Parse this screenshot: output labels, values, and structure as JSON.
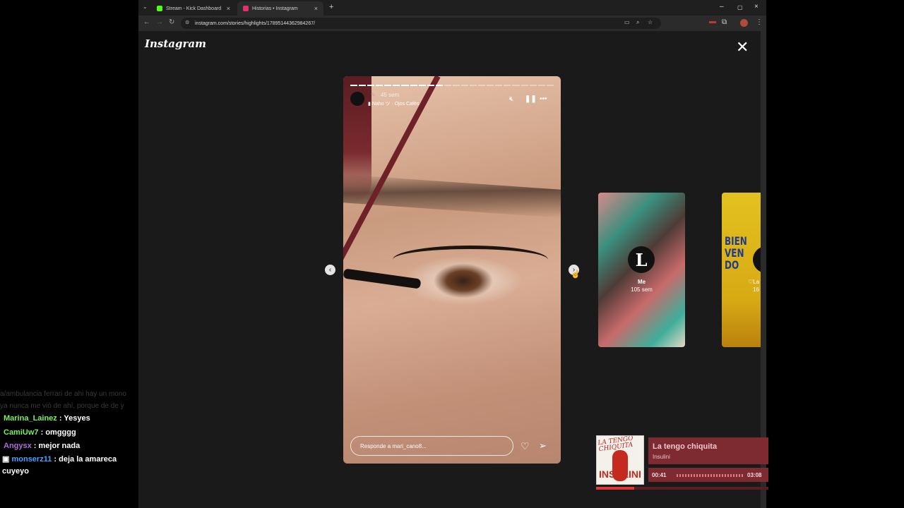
{
  "chat": {
    "faded": [
      "a/ambulancia ferrari de ahi hay un mono",
      "ya nunca me vió de ahí, porque de de y"
    ],
    "messages": [
      {
        "user": "Marina_Lainez",
        "text": "Yesyes",
        "color": "#7bf05a"
      },
      {
        "user": "CamiUw7",
        "text": "omgggg",
        "color": "#7bf05a"
      },
      {
        "user": "Angysx",
        "text": "mejor nada",
        "color": "#b06be0"
      },
      {
        "user": "monserz11",
        "text": "deja la amareca cuyeyo",
        "color": "#4da0ff"
      }
    ]
  },
  "browser": {
    "tabs": [
      {
        "title": "Stream - Kick Dashboard",
        "favicon_color": "#53fc18"
      },
      {
        "title": "Historias • Instagram",
        "favicon_color": "#e1306c"
      }
    ],
    "url": "instagram.com/stories/highlights/17895144362984267/"
  },
  "instagram": {
    "logo": "Instagram",
    "story": {
      "time": "45 sem",
      "music": "Naho ツ · Ojos Cafés",
      "reply_placeholder": "Responde a mari_cano8...",
      "segments_total": 24,
      "segments_done": 11
    },
    "next_highlights": [
      {
        "name": "Me",
        "time": "105 sem",
        "avatar_letter": "L"
      },
      {
        "name": "♡La",
        "time": "16",
        "cover_text": "BIEN VEN DO"
      }
    ]
  },
  "now_playing": {
    "title": "La tengo chiquita",
    "artist": "Insulini",
    "current": "00:41",
    "total": "03:08",
    "progress": 0.22,
    "art_title": "LA TENGO CHIQUITA",
    "art_bottom": "INSULINI"
  }
}
